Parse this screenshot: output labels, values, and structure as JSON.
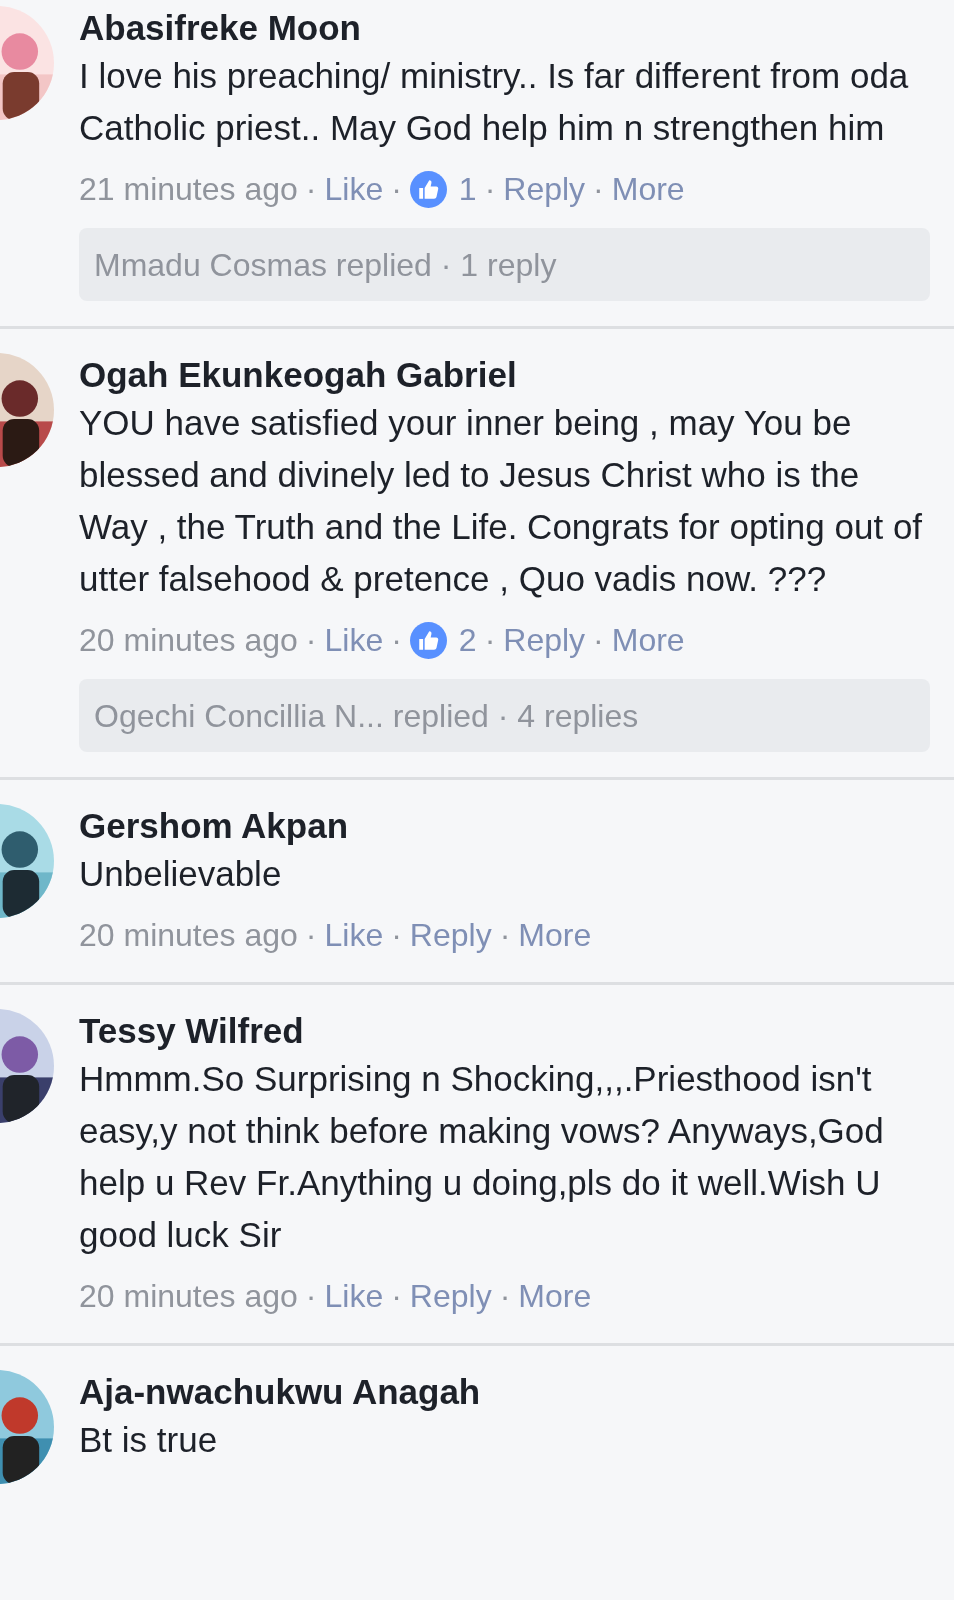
{
  "comments": [
    {
      "name": "Abasifreke Moon",
      "text": "I love his preaching/ ministry.. Is far different from oda Catholic priest.. May God help him n strengthen him",
      "meta": [
        {
          "kind": "time",
          "text": "21 minutes ago"
        },
        {
          "kind": "sep",
          "text": "·"
        },
        {
          "kind": "link",
          "text": "Like"
        },
        {
          "kind": "sep",
          "text": "·"
        },
        {
          "kind": "reactions",
          "text": "1"
        },
        {
          "kind": "sep",
          "text": "·"
        },
        {
          "kind": "link",
          "text": "Reply"
        },
        {
          "kind": "sep",
          "text": "·"
        },
        {
          "kind": "link",
          "text": "More"
        }
      ],
      "replies_summary": "Mmadu Cosmas replied · 1 reply"
    },
    {
      "name": "Ogah Ekunkeogah Gabriel",
      "text": "YOU have satisfied your inner being , may You be blessed and divinely led to Jesus Christ who is the Way , the Truth and the Life. Congrats for opting out of utter falsehood & pretence , Quo vadis now. ???",
      "meta": [
        {
          "kind": "time",
          "text": "20 minutes ago"
        },
        {
          "kind": "sep",
          "text": "·"
        },
        {
          "kind": "link",
          "text": "Like"
        },
        {
          "kind": "sep",
          "text": "·"
        },
        {
          "kind": "reactions",
          "text": "2"
        },
        {
          "kind": "sep",
          "text": "·"
        },
        {
          "kind": "link",
          "text": "Reply"
        },
        {
          "kind": "sep",
          "text": "·"
        },
        {
          "kind": "link",
          "text": "More"
        }
      ],
      "replies_summary": "Ogechi Concillia N... replied · 4 replies"
    },
    {
      "name": "Gershom Akpan",
      "text": "Unbelievable",
      "meta": [
        {
          "kind": "time",
          "text": "20 minutes ago"
        },
        {
          "kind": "sep",
          "text": "·"
        },
        {
          "kind": "link",
          "text": "Like"
        },
        {
          "kind": "sep",
          "text": "·"
        },
        {
          "kind": "link",
          "text": "Reply"
        },
        {
          "kind": "sep",
          "text": "·"
        },
        {
          "kind": "link",
          "text": "More"
        }
      ]
    },
    {
      "name": "Tessy Wilfred",
      "text": "Hmmm.So Surprising n Shocking,,,.Priesthood isn't easy,y not think before making vows? Anyways,God help u Rev Fr.Anything u doing,pls do it well.Wish U good luck Sir",
      "meta": [
        {
          "kind": "time",
          "text": "20 minutes ago"
        },
        {
          "kind": "sep",
          "text": "·"
        },
        {
          "kind": "link",
          "text": "Like"
        },
        {
          "kind": "sep",
          "text": "·"
        },
        {
          "kind": "link",
          "text": "Reply"
        },
        {
          "kind": "sep",
          "text": "·"
        },
        {
          "kind": "link",
          "text": "More"
        }
      ]
    },
    {
      "name": "Aja-nwachukwu Anagah",
      "text": "Bt is true"
    }
  ]
}
